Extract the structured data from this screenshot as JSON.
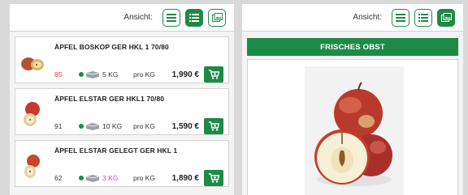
{
  "left": {
    "view_label": "Ansicht:",
    "products": [
      {
        "name": "ÄPFEL BOSKOP GER HKL 1 70/80",
        "stock": "85",
        "stock_color": "#e53935",
        "package": "5 KG",
        "package_color": "#333333",
        "unit": "pro KG",
        "price": "1,990 €"
      },
      {
        "name": "ÄPFEL ELSTAR GER HKL1 70/80",
        "stock": "91",
        "stock_color": "#333333",
        "package": "10 KG",
        "package_color": "#333333",
        "unit": "pro KG",
        "price": "1,590 €"
      },
      {
        "name": "ÄPFEL ELSTAR GELEGT GER HKL 1",
        "stock": "62",
        "stock_color": "#333333",
        "package": "3 KG",
        "package_color": "#e040a0",
        "unit": "pro KG",
        "price": "1,890 €"
      }
    ]
  },
  "right": {
    "view_label": "Ansicht:",
    "category_title": "FRISCHES OBST"
  },
  "colors": {
    "accent": "#1e8a47",
    "stock_low": "#e53935",
    "package_highlight": "#e040a0"
  },
  "icons": [
    "list-view-icon",
    "detail-list-view-icon",
    "gallery-view-icon",
    "cart-icon",
    "package-icon"
  ]
}
